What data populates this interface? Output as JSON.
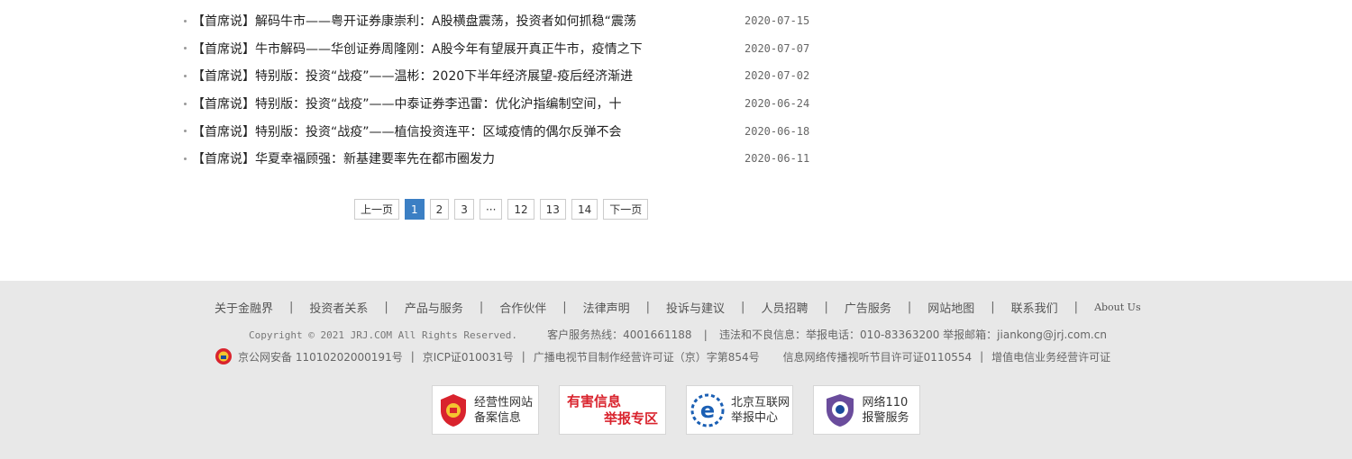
{
  "news": [
    {
      "title": "【首席说】解码牛市——粤开证券康崇利：A股横盘震荡，投资者如何抓稳“震荡",
      "date": "2020-07-15"
    },
    {
      "title": "【首席说】牛市解码——华创证券周隆刚：A股今年有望展开真正牛市，疫情之下",
      "date": "2020-07-07"
    },
    {
      "title": "【首席说】特别版：投资“战疫”——温彬：2020下半年经济展望-疫后经济渐进",
      "date": "2020-07-02"
    },
    {
      "title": "【首席说】特别版：投资“战疫”——中泰证券李迅雷：优化沪指编制空间，十",
      "date": "2020-06-24"
    },
    {
      "title": "【首席说】特别版：投资“战疫”——植信投资连平：区域疫情的偶尔反弹不会",
      "date": "2020-06-18"
    },
    {
      "title": "【首席说】华夏幸福顾强：新基建要率先在都市圈发力",
      "date": "2020-06-11"
    }
  ],
  "pager": {
    "prev": "上一页",
    "pages": [
      "1",
      "2",
      "3",
      "···",
      "12",
      "13",
      "14"
    ],
    "next": "下一页",
    "current": "1"
  },
  "footer": {
    "links": [
      "关于金融界",
      "投资者关系",
      "产品与服务",
      "合作伙伴",
      "法律声明",
      "投诉与建议",
      "人员招聘",
      "广告服务",
      "网站地图",
      "联系我们",
      "About Us"
    ],
    "separator": "|",
    "copyright": "Copyright © 2021 JRJ.COM All Rights Reserved.",
    "hotline": "客户服务热线：4001661188",
    "report": "违法和不良信息：举报电话：010-83363200 举报邮箱：jiankong@jrj.com.cn",
    "licenses": [
      "京公网安备 11010202000191号",
      "京ICP证010031号",
      "广播电视节目制作经营许可证（京）字第854号",
      "信息网络传播视听节目许可证0110554",
      "增值电信业务经营许可证"
    ],
    "badges": [
      {
        "line1": "经营性网站",
        "line2": "备案信息",
        "icon": "shield-badge-icon"
      },
      {
        "line1": "有害信息",
        "line2": "举报专区",
        "icon": "none"
      },
      {
        "line1": "北京互联网",
        "line2": "举报中心",
        "icon": "e-globe-icon"
      },
      {
        "line1": "网络110",
        "line2": "报警服务",
        "icon": "police-shield-icon"
      }
    ]
  },
  "colors": {
    "accent": "#3b7fc4",
    "footer_bg": "#e8e8e8",
    "red": "#d9232d"
  }
}
